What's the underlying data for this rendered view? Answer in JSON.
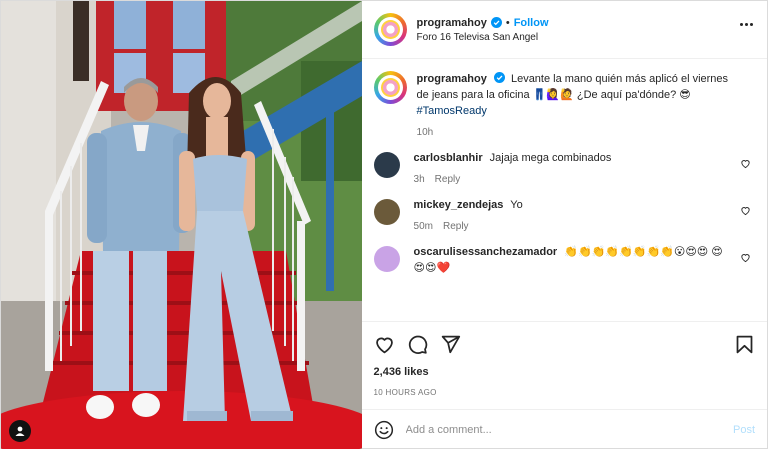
{
  "post": {
    "username": "programahoy",
    "follow_label": "Follow",
    "separator": "•",
    "location": "Foro 16 Televisa San Angel",
    "more_icon": "more-horizontal-icon"
  },
  "caption": {
    "username": "programahoy",
    "text": "Levante la mano quién más aplicó el viernes de jeans para la oficina",
    "emoji_1": "👖🙋‍♀️🙋",
    "text_2": "¿De aquí pa'dónde?",
    "emoji_2": "😎",
    "hashtag": "#TamosReady",
    "time": "10h"
  },
  "comments": [
    {
      "username": "carlosblanhir",
      "text": "Jajaja mega combinados",
      "time": "3h",
      "reply": "Reply",
      "avatar_color": "#2b3a4a"
    },
    {
      "username": "mickey_zendejas",
      "text": "Yo",
      "time": "50m",
      "reply": "Reply",
      "avatar_color": "#6b5a3a"
    },
    {
      "username": "oscarulisessanchezamador",
      "text": "👏👏👏👏👏👏👏👏😮😍😍 😍😍😍❤️",
      "avatar_color": "#c9a3e6"
    }
  ],
  "actions": {
    "likes": "2,436 likes",
    "time": "10 HOURS AGO"
  },
  "add_comment": {
    "placeholder": "Add a comment...",
    "post_label": "Post"
  },
  "colors": {
    "accent": "#0095f6",
    "hashtag": "#00376b",
    "muted": "#737373",
    "post_disabled": "#b2dffc"
  }
}
